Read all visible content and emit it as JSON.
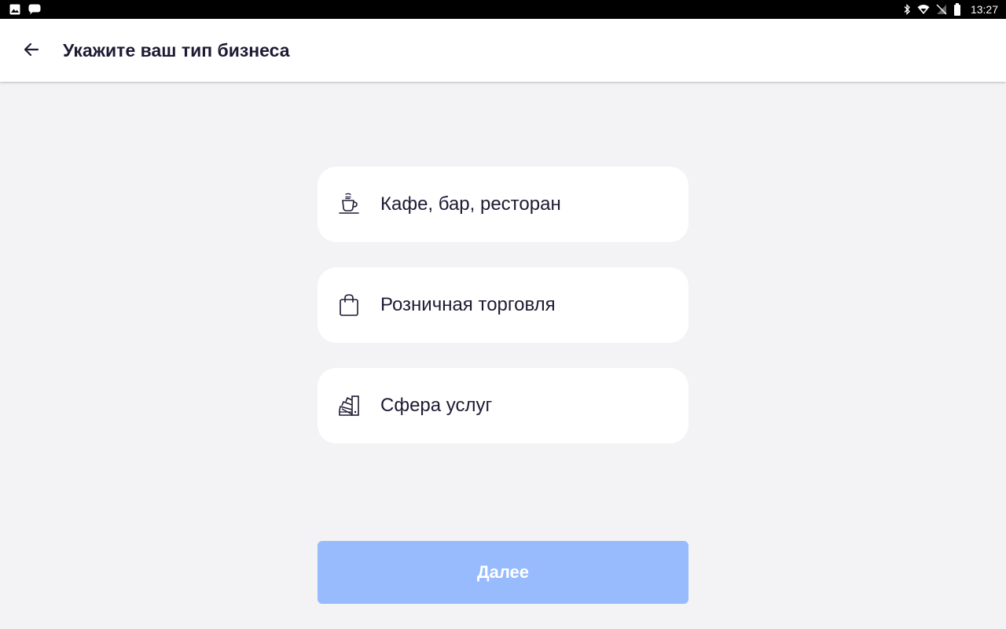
{
  "status_bar": {
    "time": "13:27",
    "left_icons": [
      "image-notification-icon",
      "message-notification-icon"
    ],
    "right_icons": [
      "bluetooth-icon",
      "wifi-icon",
      "no-signal-icon",
      "battery-icon"
    ]
  },
  "header": {
    "title": "Укажите ваш тип бизнеса",
    "back_icon": "arrow-left-icon"
  },
  "options": [
    {
      "label": "Кафе, бар, ресторан",
      "icon": "coffee-cup-icon"
    },
    {
      "label": "Розничная торговля",
      "icon": "shopping-bag-icon"
    },
    {
      "label": "Сфера услуг",
      "icon": "color-swatch-icon"
    }
  ],
  "next_button": {
    "label": "Далее",
    "state": "disabled"
  },
  "colors": {
    "background": "#f3f3f6",
    "text": "#1e1a33",
    "button_disabled": "#97bbfc"
  }
}
